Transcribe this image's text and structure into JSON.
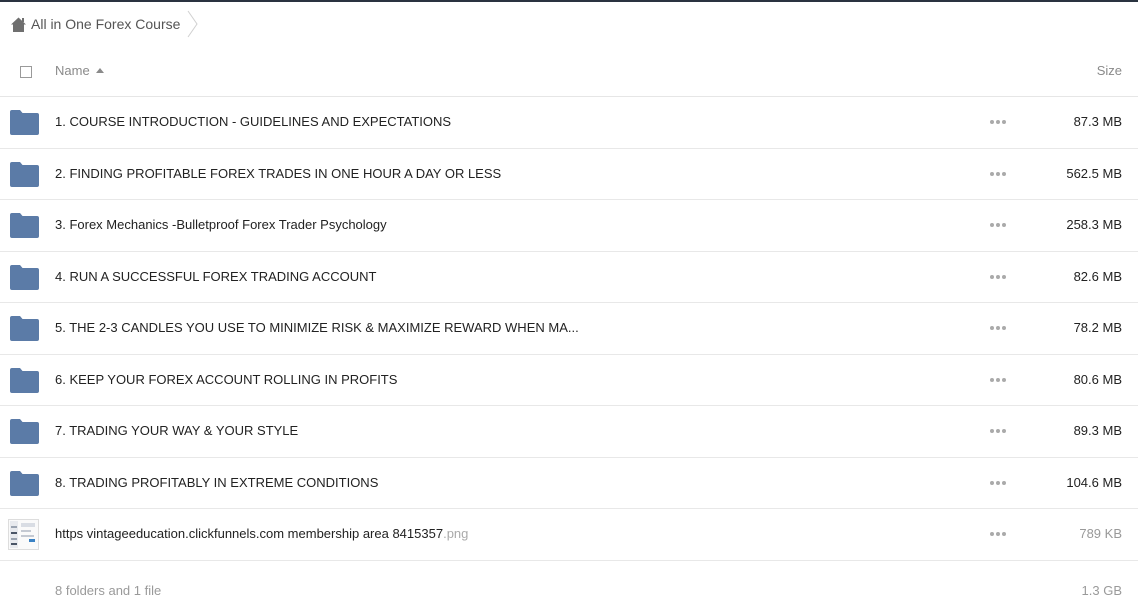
{
  "breadcrumb": {
    "label": "All in One Forex Course",
    "icon": "home-icon"
  },
  "header": {
    "name_label": "Name",
    "size_label": "Size"
  },
  "colors": {
    "folder": "#5b7ba7",
    "topline": "#2a3340"
  },
  "items": [
    {
      "type": "folder",
      "name": "1. COURSE INTRODUCTION - GUIDELINES AND EXPECTATIONS",
      "ext": "",
      "size": "87.3 MB"
    },
    {
      "type": "folder",
      "name": "2. FINDING PROFITABLE FOREX TRADES IN ONE HOUR A DAY OR LESS",
      "ext": "",
      "size": "562.5 MB"
    },
    {
      "type": "folder",
      "name": "3. Forex Mechanics -Bulletproof Forex Trader Psychology",
      "ext": "",
      "size": "258.3 MB"
    },
    {
      "type": "folder",
      "name": "4. RUN A SUCCESSFUL FOREX TRADING ACCOUNT",
      "ext": "",
      "size": "82.6 MB"
    },
    {
      "type": "folder",
      "name": "5. THE 2-3 CANDLES YOU USE TO MINIMIZE RISK & MAXIMIZE REWARD WHEN MA...",
      "ext": "",
      "size": "78.2 MB"
    },
    {
      "type": "folder",
      "name": "6. KEEP YOUR FOREX ACCOUNT ROLLING IN PROFITS",
      "ext": "",
      "size": "80.6 MB"
    },
    {
      "type": "folder",
      "name": "7. TRADING YOUR WAY & YOUR STYLE",
      "ext": "",
      "size": "89.3 MB"
    },
    {
      "type": "folder",
      "name": "8. TRADING PROFITABLY IN EXTREME CONDITIONS",
      "ext": "",
      "size": "104.6 MB"
    },
    {
      "type": "file",
      "name": "https vintageeducation.clickfunnels.com membership area 8415357",
      "ext": ".png",
      "size": "789 KB"
    }
  ],
  "footer": {
    "summary": "8 folders and 1 file",
    "total": "1.3 GB"
  }
}
